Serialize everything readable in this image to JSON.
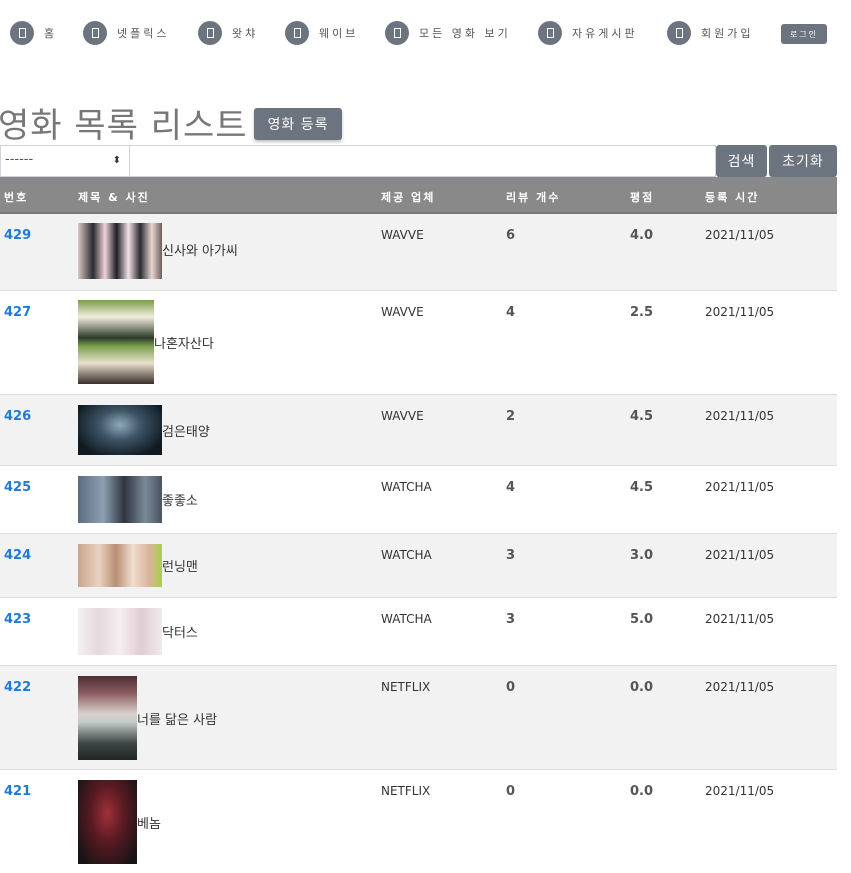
{
  "nav": {
    "items": [
      {
        "label": "홈"
      },
      {
        "label": "넷플릭스"
      },
      {
        "label": "왓챠"
      },
      {
        "label": "웨이브"
      },
      {
        "label": "모든 영화 보기"
      },
      {
        "label": "자유게시판"
      },
      {
        "label": "회원가입"
      }
    ],
    "login_label": "로그인"
  },
  "page": {
    "title": "영화 목록 리스트",
    "register_label": "영화 등록"
  },
  "search": {
    "select_value": "------",
    "input_value": "",
    "search_label": "검색",
    "reset_label": "초기화"
  },
  "table": {
    "headers": {
      "num": "번호",
      "title": "제목 & 사진",
      "company": "제공 업체",
      "review_count": "리뷰 개수",
      "rating": "평점",
      "date": "등록 시간"
    },
    "rows": [
      {
        "num": "429",
        "title": "신사와 아가씨",
        "company": "WAVVE",
        "reviews": "6",
        "rating": "4.0",
        "date": "2021/11/05"
      },
      {
        "num": "427",
        "title": "나혼자산다",
        "company": "WAVVE",
        "reviews": "4",
        "rating": "2.5",
        "date": "2021/11/05"
      },
      {
        "num": "426",
        "title": "검은태양",
        "company": "WAVVE",
        "reviews": "2",
        "rating": "4.5",
        "date": "2021/11/05"
      },
      {
        "num": "425",
        "title": "좋좋소",
        "company": "WATCHA",
        "reviews": "4",
        "rating": "4.5",
        "date": "2021/11/05"
      },
      {
        "num": "424",
        "title": "런닝맨",
        "company": "WATCHA",
        "reviews": "3",
        "rating": "3.0",
        "date": "2021/11/05"
      },
      {
        "num": "423",
        "title": "닥터스",
        "company": "WATCHA",
        "reviews": "3",
        "rating": "5.0",
        "date": "2021/11/05"
      },
      {
        "num": "422",
        "title": "너를 닮은 사람",
        "company": "NETFLIX",
        "reviews": "0",
        "rating": "0.0",
        "date": "2021/11/05"
      },
      {
        "num": "421",
        "title": "베놈",
        "company": "NETFLIX",
        "reviews": "0",
        "rating": "0.0",
        "date": "2021/11/05"
      }
    ]
  },
  "colors": {
    "button_gray": "#6c7480",
    "header_gray": "#898989",
    "link_blue": "#1f7ad6",
    "stripe": "#f2f2f2"
  }
}
